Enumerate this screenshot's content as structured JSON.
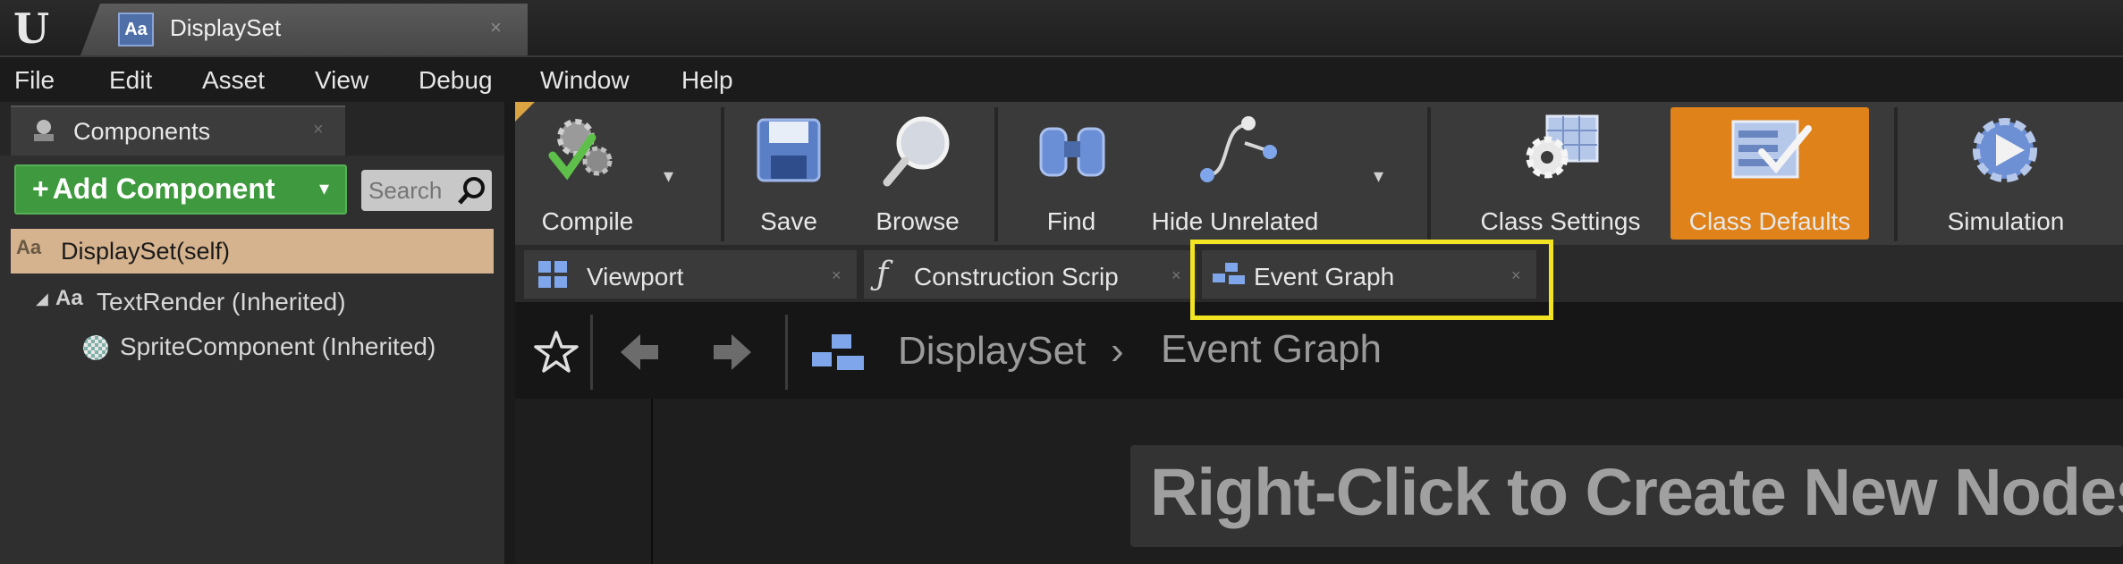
{
  "window": {
    "tab_title": "DisplaySet",
    "tab_icon_text": "Aa",
    "tab_close": "×"
  },
  "menu": [
    "File",
    "Edit",
    "Asset",
    "View",
    "Debug",
    "Window",
    "Help"
  ],
  "components_panel": {
    "tab_label": "Components",
    "tab_close": "×",
    "add_button_label": "Add Component",
    "add_button_plus": "+",
    "add_button_caret": "▾",
    "search_placeholder": "Search",
    "self_icon_text": "Aa",
    "self_label": "DisplaySet(self)",
    "tree": [
      {
        "arrow": "◢",
        "icon_text": "Aa",
        "label": "TextRender (Inherited)"
      },
      {
        "label": "SpriteComponent (Inherited)"
      }
    ]
  },
  "toolbar": {
    "compile": "Compile",
    "save": "Save",
    "browse": "Browse",
    "find": "Find",
    "hide_unrelated": "Hide Unrelated",
    "class_settings": "Class Settings",
    "class_defaults": "Class Defaults",
    "simulation": "Simulation",
    "caret": "▾",
    "active_color": "#e0821a"
  },
  "graph_tabs": [
    {
      "label": "Viewport",
      "close": "×"
    },
    {
      "label": "Construction Scrip",
      "close": "×"
    },
    {
      "label": "Event Graph",
      "close": "×"
    }
  ],
  "highlight_color": "#f2e423",
  "graph": {
    "breadcrumb_asset": "DisplaySet",
    "breadcrumb_sep": "›",
    "breadcrumb_graph": "Event Graph",
    "hint": "Right-Click to Create New Nodes."
  }
}
